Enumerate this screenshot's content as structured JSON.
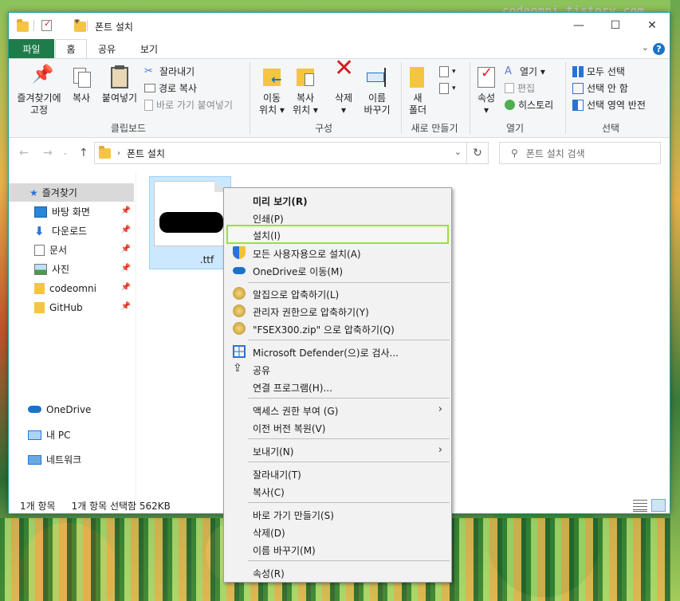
{
  "watermark": "codeomni.tistory.com",
  "window": {
    "title": "폰트 설치",
    "controls": {
      "minimize": "—",
      "maximize": "☐",
      "close": "✕"
    }
  },
  "menu": {
    "file": "파일",
    "tabs": [
      "홈",
      "공유",
      "보기"
    ],
    "help": "?"
  },
  "ribbon": {
    "clipboard": {
      "pin_label_1": "즐겨찾기에",
      "pin_label_2": "고정",
      "copy": "복사",
      "paste": "붙여넣기",
      "cut": "잘라내기",
      "copy_path": "경로 복사",
      "paste_shortcut": "바로 가기 붙여넣기",
      "group": "클립보드"
    },
    "organize": {
      "move_1": "이동",
      "move_2": "위치 ▾",
      "copyto_1": "복사",
      "copyto_2": "위치 ▾",
      "delete_1": "삭제",
      "delete_2": "▾",
      "rename_1": "이름",
      "rename_2": "바꾸기",
      "group": "구성"
    },
    "new": {
      "folder_1": "새",
      "folder_2": "폴더",
      "group": "새로 만들기"
    },
    "open": {
      "props": "속성",
      "props_arrow": "▾",
      "open": "열기 ▾",
      "edit": "편집",
      "history": "히스토리",
      "group": "열기"
    },
    "select": {
      "all": "모두 선택",
      "none": "선택 안 함",
      "invert": "선택 영역 반전",
      "group": "선택"
    }
  },
  "address": {
    "path": "폰트 설치",
    "search_placeholder": "폰트 설치 검색"
  },
  "nav": {
    "favorites": "즐겨찾기",
    "items": [
      "바탕 화면",
      "다운로드",
      "문서",
      "사진",
      "codeomni",
      "GitHub"
    ],
    "onedrive": "OneDrive",
    "pc": "내 PC",
    "network": "네트워크"
  },
  "file": {
    "name": ".ttf"
  },
  "status": {
    "count": "1개 항목",
    "selected": "1개 항목 선택함 562KB"
  },
  "context_menu": {
    "preview": "미리 보기(R)",
    "print": "인쇄(P)",
    "install": "설치(I)",
    "install_all": "모든 사용자용으로 설치(A)",
    "onedrive": "OneDrive로 이동(M)",
    "zip1": "알집으로 압축하기(L)",
    "zip2": "관리자 권한으로 압축하기(Y)",
    "zip3": "\"FSEX300.zip\" 으로 압축하기(Q)",
    "defender": "Microsoft Defender(으)로 검사...",
    "share": "공유",
    "openwith": "연결 프로그램(H)...",
    "access": "액세스 권한 부여 (G)",
    "restore": "이전 버전 복원(V)",
    "sendto": "보내기(N)",
    "cut": "잘라내기(T)",
    "copy": "복사(C)",
    "shortcut": "바로 가기 만들기(S)",
    "delete": "삭제(D)",
    "rename": "이름 바꾸기(M)",
    "properties": "속성(R)"
  }
}
